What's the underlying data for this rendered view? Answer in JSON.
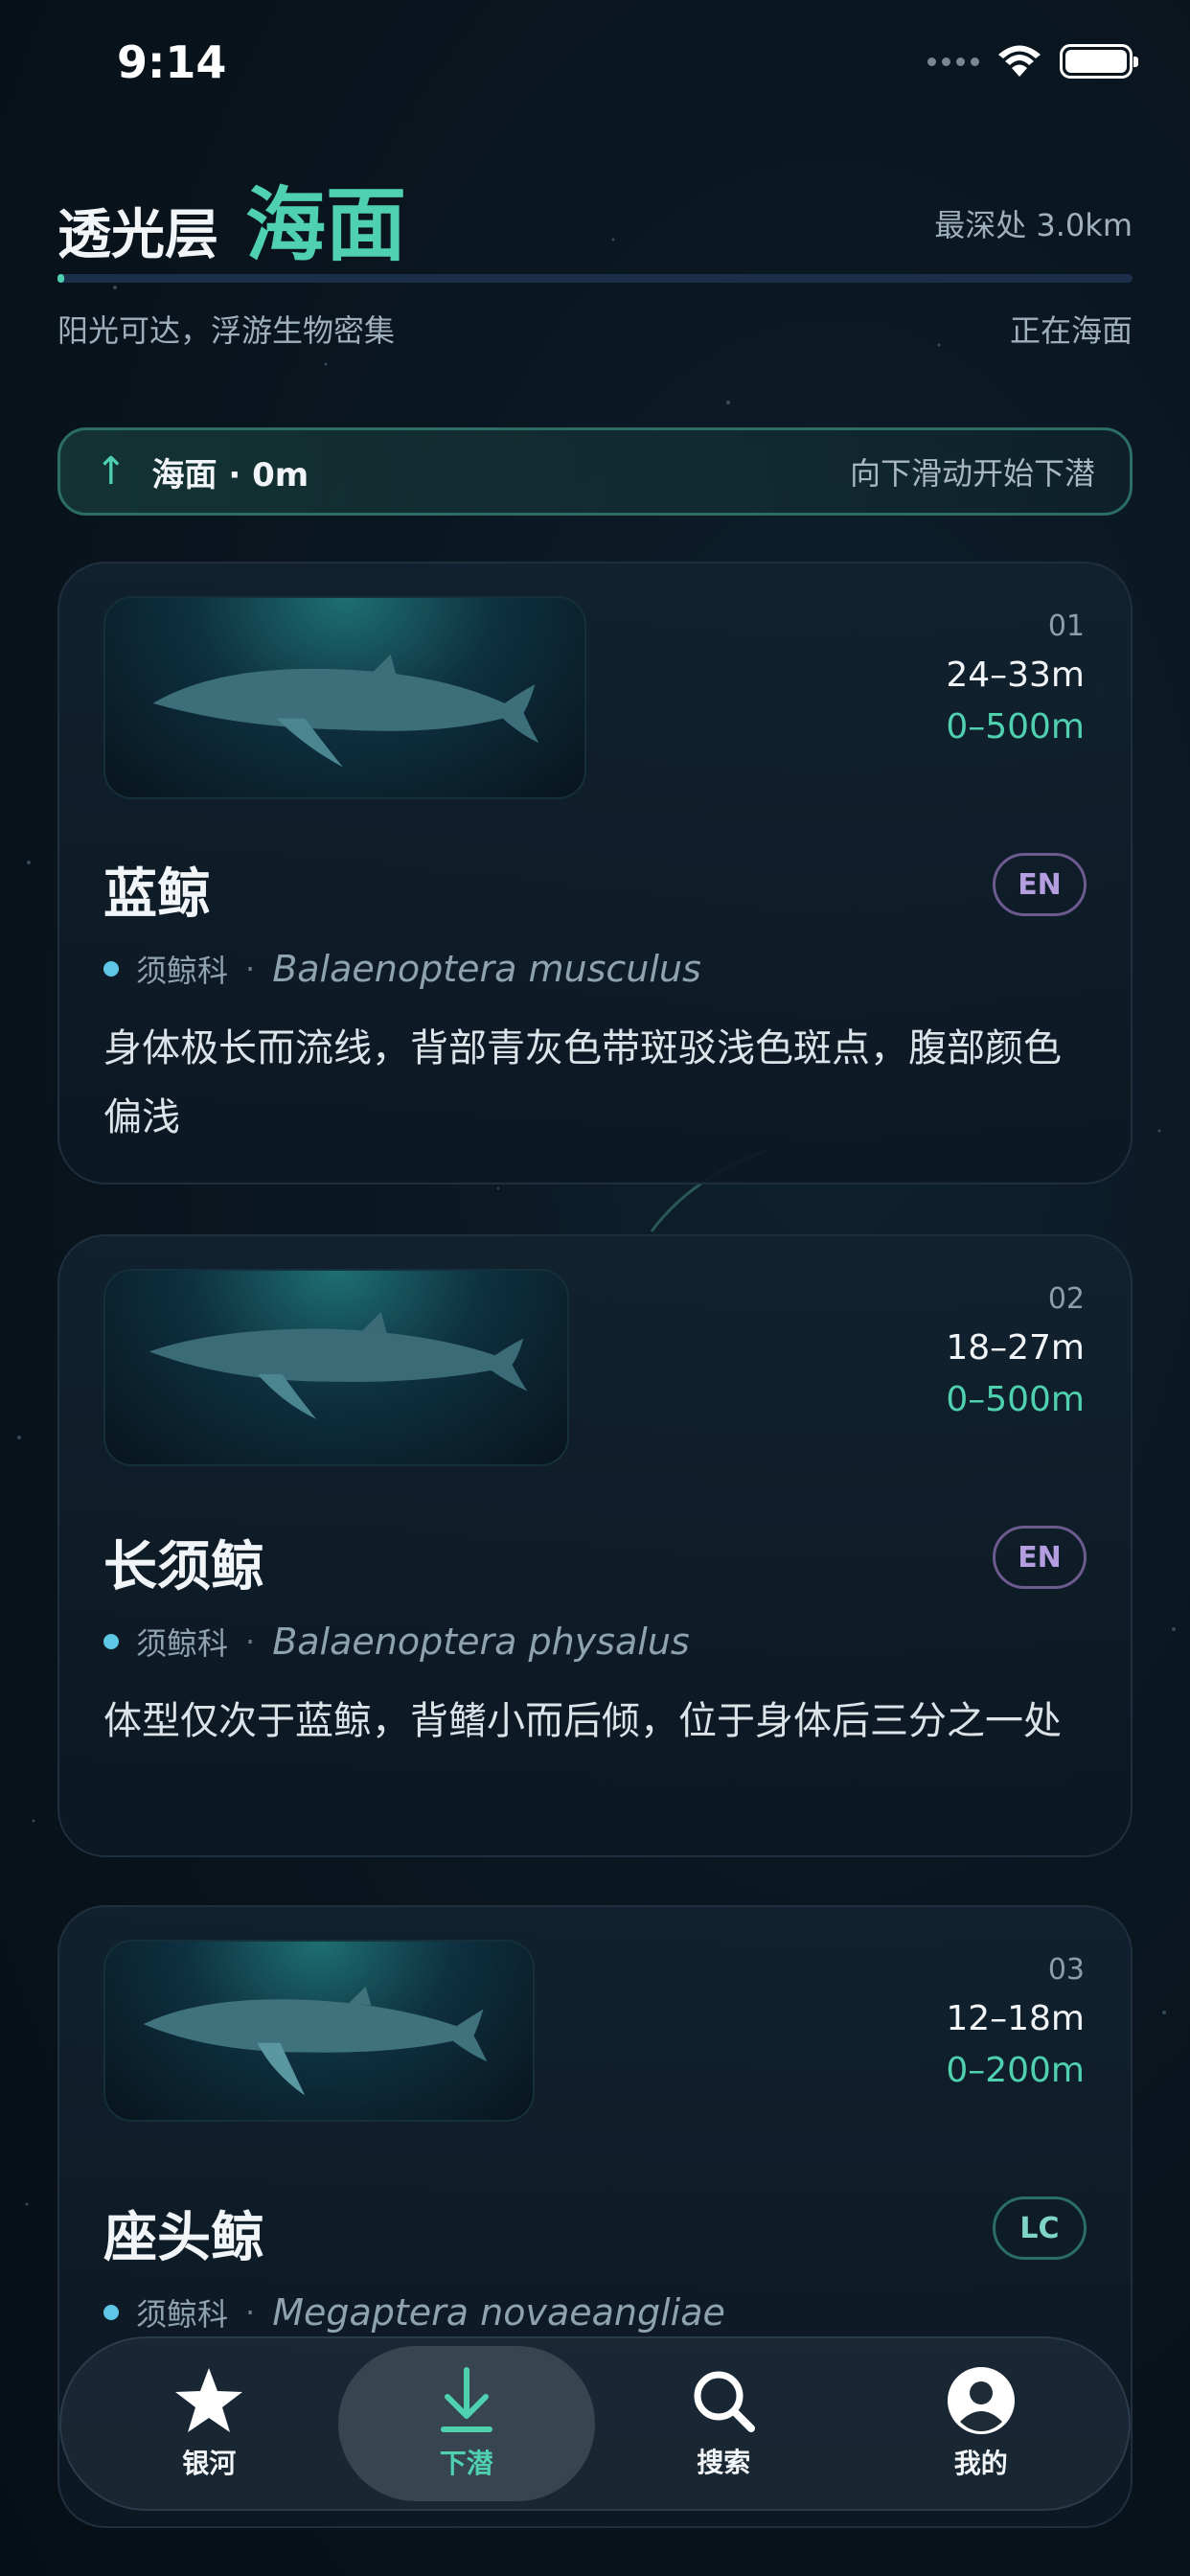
{
  "status_bar": {
    "time": "9:14"
  },
  "header": {
    "layer_name": "透光层",
    "zone_name": "海面",
    "max_depth": "最深处 3.0km",
    "progress": 0.0,
    "zone_description": "阳光可达，浮游生物密集",
    "zone_status": "正在海面"
  },
  "depth_banner": {
    "label": "海面 · 0m",
    "hint": "向下滑动开始下潜"
  },
  "species": [
    {
      "index": "01",
      "size": "24–33m",
      "depth": "0–500m",
      "name": "蓝鲸",
      "status": "EN",
      "family": "须鲸科",
      "separator": "·",
      "latin": "Balaenoptera musculus",
      "description": "身体极长而流线，背部青灰色带斑驳浅色斑点，腹部颜色偏浅"
    },
    {
      "index": "02",
      "size": "18–27m",
      "depth": "0–500m",
      "name": "长须鲸",
      "status": "EN",
      "family": "须鲸科",
      "separator": "·",
      "latin": "Balaenoptera physalus",
      "description": "体型仅次于蓝鲸，背鳍小而后倾，位于身体后三分之一处"
    },
    {
      "index": "03",
      "size": "12–18m",
      "depth": "0–200m",
      "name": "座头鲸",
      "status": "LC",
      "family": "须鲸科",
      "separator": "·",
      "latin": "Megaptera novaeangliae",
      "description": ""
    }
  ],
  "tabbar": {
    "tabs": [
      {
        "label": "银河",
        "icon": "star-icon"
      },
      {
        "label": "下潜",
        "icon": "download-arrow-icon",
        "active": true
      },
      {
        "label": "搜索",
        "icon": "search-icon"
      },
      {
        "label": "我的",
        "icon": "user-icon"
      }
    ]
  },
  "colors": {
    "accent": "#4fd1b0",
    "background": "#0a1620",
    "endangered_badge": "#b49ee0",
    "least_concern_badge": "#7fd6c4"
  }
}
